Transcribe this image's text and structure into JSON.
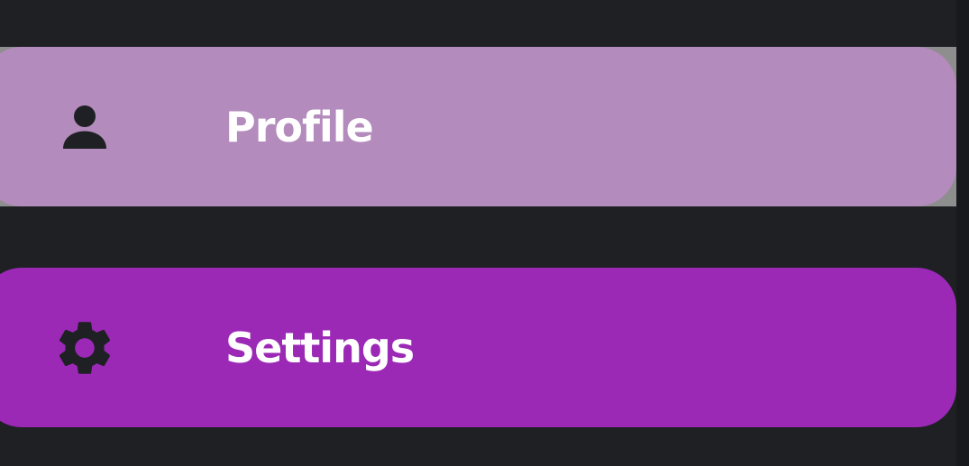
{
  "colors": {
    "background": "#1f2024",
    "edge": "#18191c",
    "press_highlight": "#8e8e8e",
    "profile_item": "#b38bbc",
    "settings_item": "#9b29b6",
    "icon": "#1f2024",
    "label": "#ffffff"
  },
  "menu": {
    "items": [
      {
        "label": "Profile",
        "icon": "person-icon",
        "state": "pressed"
      },
      {
        "label": "Settings",
        "icon": "gear-icon",
        "state": "normal"
      }
    ]
  }
}
